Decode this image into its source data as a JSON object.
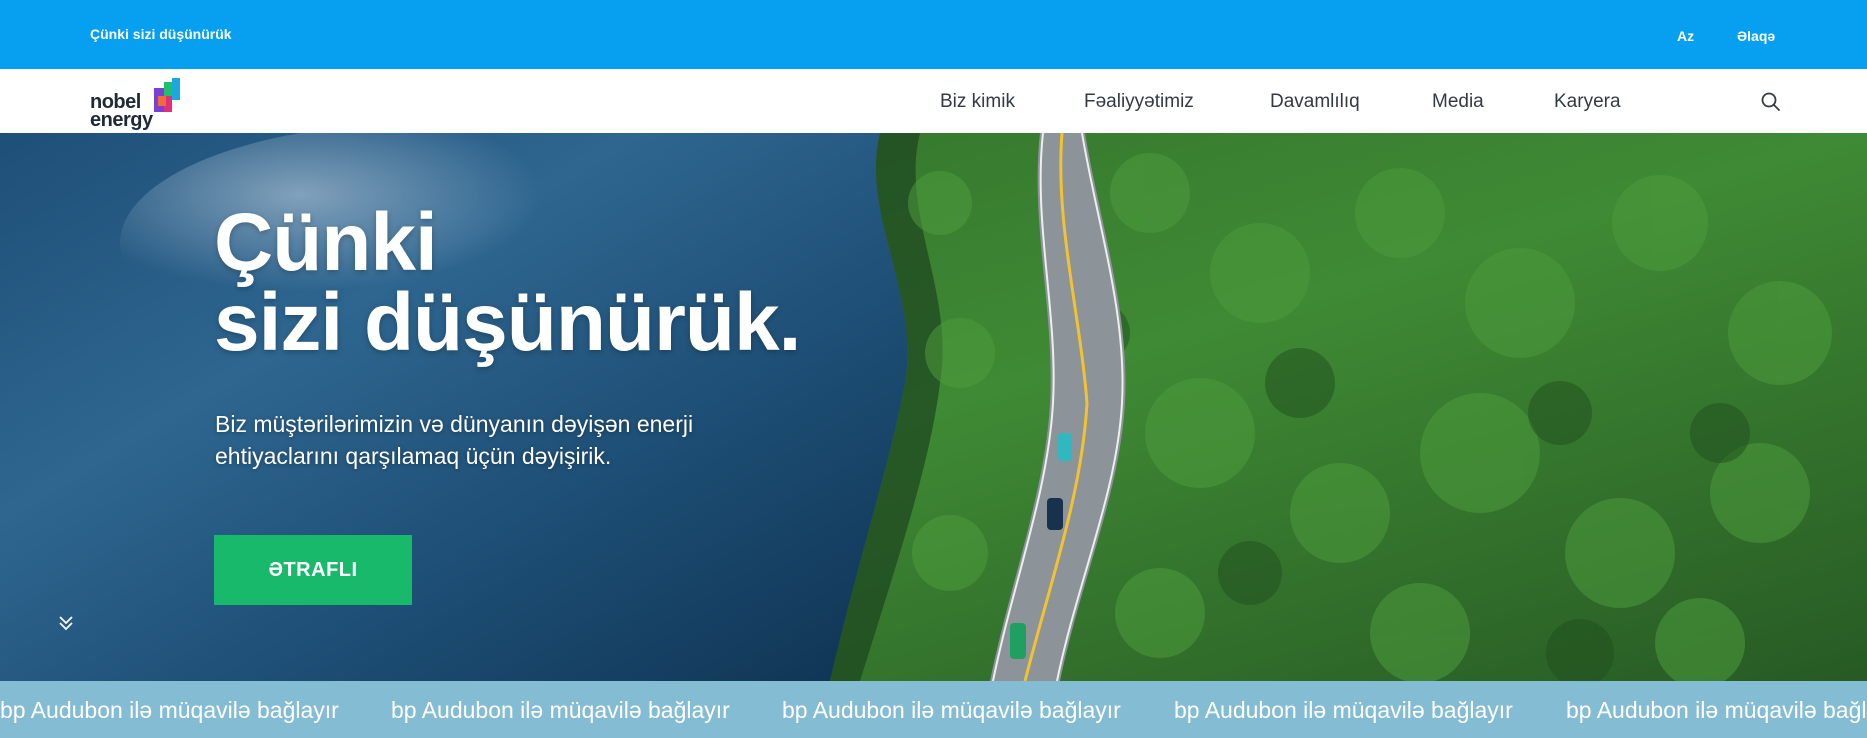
{
  "topbar": {
    "tagline": "Çünki sizi düşünürük",
    "lang": "Az",
    "contact": "Əlaqə",
    "bg_color": "#079ff0"
  },
  "logo": {
    "line1": "nobel",
    "line2": "energy"
  },
  "nav": {
    "items": [
      "Biz kimik",
      "Fəaliyyətimiz",
      "Davamlılıq",
      "Media",
      "Karyera"
    ],
    "search_icon": "search-icon"
  },
  "hero": {
    "title_line1": "Çünki",
    "title_line2": "sizi düşünürük.",
    "subtitle": "Biz müştərilərimizin və dünyanın dəyişən enerji ehtiyaclarını qarşılamaq üçün dəyişirik.",
    "cta_label": "ƏTRAFLI",
    "cta_color": "#19b96b",
    "scroll_icon": "double-chevron-down-icon"
  },
  "ticker": {
    "items": [
      "bp Audubon ilə müqavilə bağlayır",
      "bp Audubon ilə müqavilə bağlayır",
      "bp Audubon ilə müqavilə bağlayır",
      "bp Audubon ilə müqavilə bağlayır",
      "bp Audubon ilə müqavilə bağlayır"
    ],
    "bg_color": "#84bdd3"
  }
}
